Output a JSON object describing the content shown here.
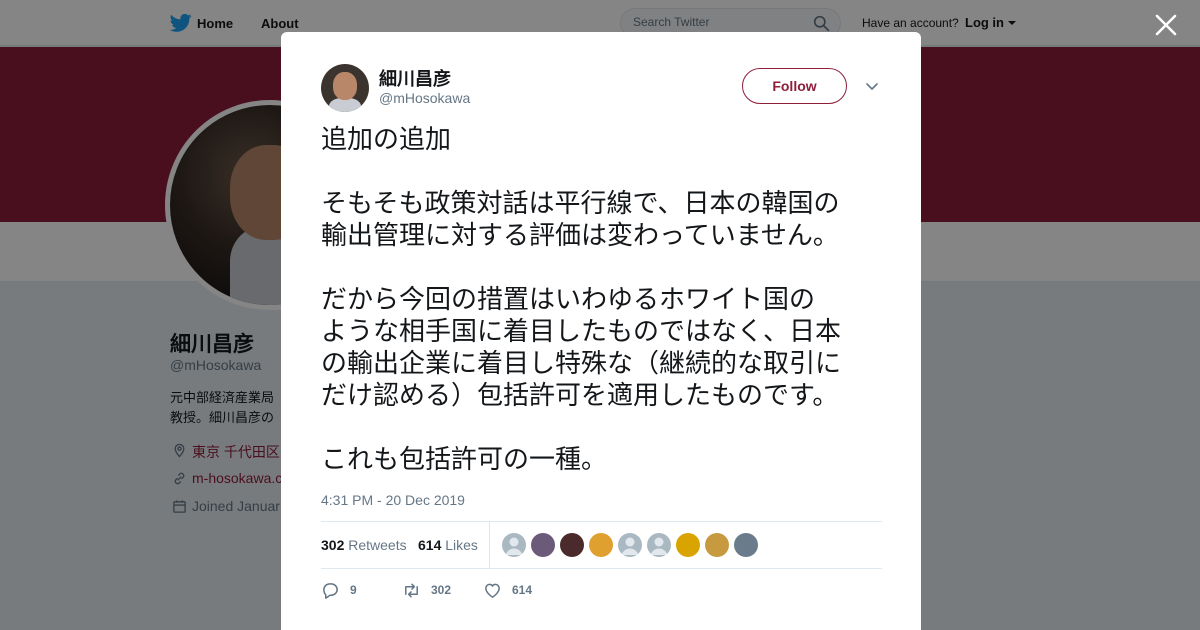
{
  "header": {
    "nav_home": "Home",
    "nav_about": "About",
    "search_placeholder": "Search Twitter",
    "have_account": "Have an account?",
    "login": "Log in"
  },
  "profile": {
    "name": "細川昌彦",
    "handle": "@mHosokawa",
    "bio_line1": "元中部経済産業局",
    "bio_line2": "教授。細川昌彦の",
    "location": "東京 千代田区",
    "url": "m-hosokawa.c",
    "joined": "Joined Januar"
  },
  "tweet": {
    "author_name": "細川昌彦",
    "author_handle": "@mHosokawa",
    "follow_label": "Follow",
    "paragraphs": [
      "追加の追加",
      "そもそも政策対話は平行線で、日本の韓国の\n輸出管理に対する評価は変わっていません。",
      "だから今回の措置はいわゆるホワイト国の\nような相手国に着目したものではなく、日本\nの輸出企業に着目し特殊な（継続的な取引に\nだけ認める）包括許可を適用したものです。",
      "これも包括許可の一種。"
    ],
    "timestamp": "4:31 PM - 20 Dec 2019",
    "retweets_count": "302",
    "retweets_label": "Retweets",
    "likes_count": "614",
    "likes_label": "Likes",
    "liker_avatars": [
      {
        "name": "liker-default-avatar",
        "color": "#aab8c2"
      },
      {
        "name": "liker-pattern-avatar",
        "color": "#6b5a7a"
      },
      {
        "name": "liker-dark-avatar",
        "color": "#4a2a2a"
      },
      {
        "name": "liker-colorful-avatar",
        "color": "#e0a030"
      },
      {
        "name": "liker-default-avatar",
        "color": "#aab8c2"
      },
      {
        "name": "liker-default-avatar",
        "color": "#aab8c2"
      },
      {
        "name": "liker-flower-avatar",
        "color": "#d9a400"
      },
      {
        "name": "liker-dog-avatar",
        "color": "#c89a40"
      },
      {
        "name": "liker-landscape-avatar",
        "color": "#6a7c8c"
      }
    ],
    "reply_count": "9",
    "retweet_action_count": "302",
    "like_action_count": "614"
  },
  "colors": {
    "accent": "#8e1e3a",
    "twitter_blue": "#1da1f2",
    "muted": "#657786"
  }
}
